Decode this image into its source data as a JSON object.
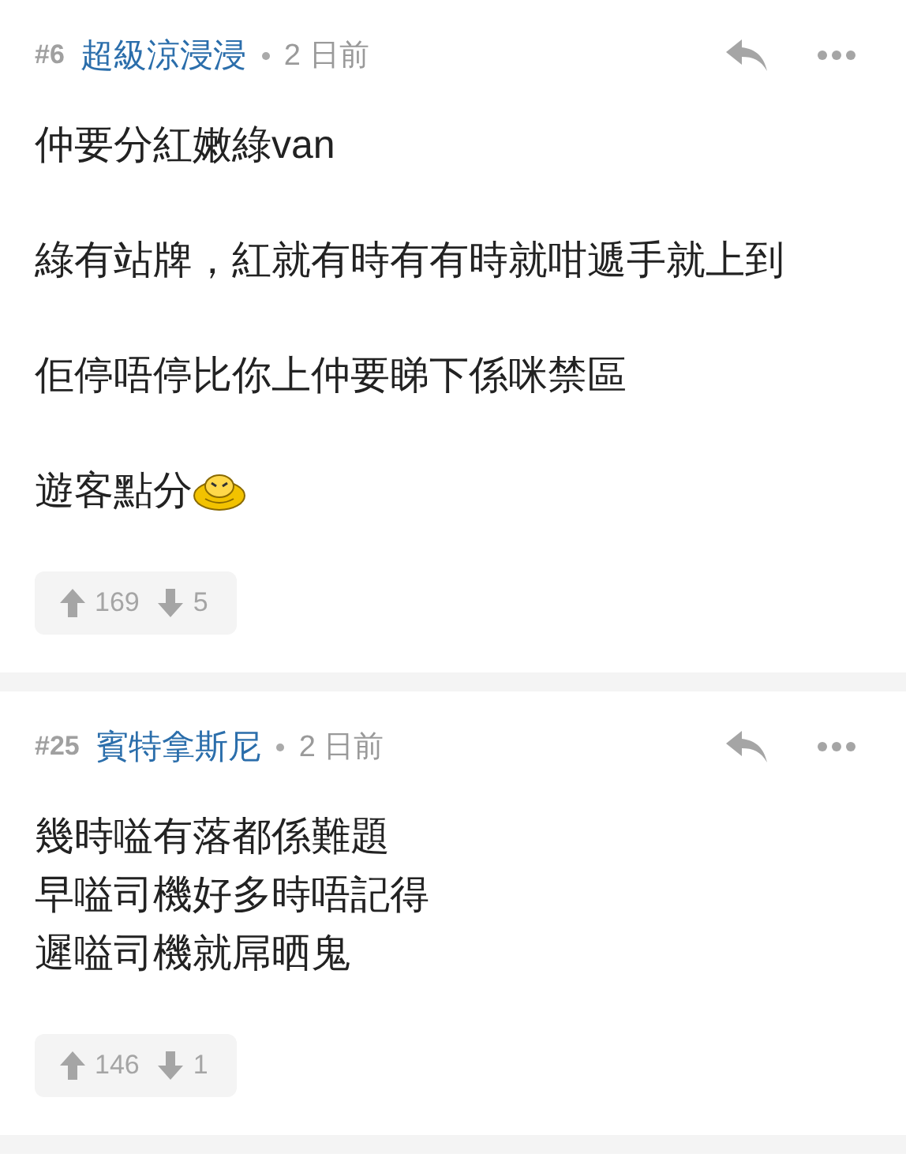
{
  "posts": [
    {
      "number": "#6",
      "author": "超級涼浸浸",
      "time": "2 日前",
      "paragraphs": [
        {
          "lines": [
            "仲要分紅嫩綠van"
          ],
          "has_icon": false
        },
        {
          "lines": [
            "綠有站牌，紅就有時有有時就咁遞手就上到"
          ],
          "has_icon": false
        },
        {
          "lines": [
            "佢停唔停比你上仲要睇下係咪禁區"
          ],
          "has_icon": false
        },
        {
          "lines": [
            "遊客點分"
          ],
          "has_icon": true
        }
      ],
      "upvotes": "169",
      "downvotes": "5"
    },
    {
      "number": "#25",
      "author": "賓特拿斯尼",
      "time": "2 日前",
      "paragraphs": [
        {
          "lines": [
            "幾時嗌有落都係難題",
            "早嗌司機好多時唔記得",
            "遲嗌司機就屌晒鬼"
          ],
          "has_icon": false
        }
      ],
      "upvotes": "146",
      "downvotes": "1"
    }
  ]
}
